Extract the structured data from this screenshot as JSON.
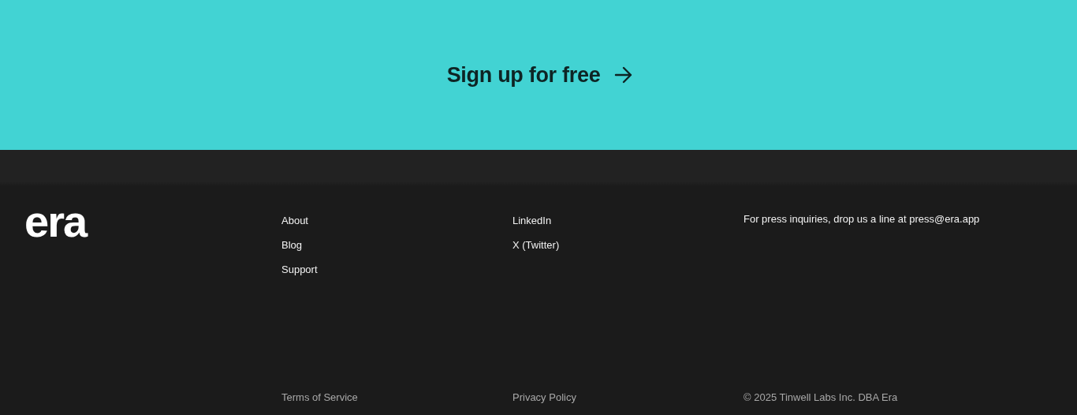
{
  "cta": {
    "label": "Sign up for free"
  },
  "footer": {
    "logo": "era",
    "links_column_1": [
      "About",
      "Blog",
      "Support"
    ],
    "links_column_2": [
      "LinkedIn",
      "X (Twitter)"
    ],
    "press_note": "For press inquiries, drop us a line at press@era.app",
    "bottom": {
      "terms": "Terms of Service",
      "privacy": "Privacy Policy",
      "copyright": "© 2025 Tinwell Labs Inc. DBA Era"
    }
  }
}
